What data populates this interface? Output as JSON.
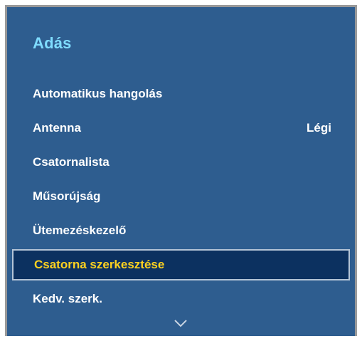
{
  "colors": {
    "panel_bg": "#2e5d8f",
    "title": "#7fdcff",
    "text": "#ffffff",
    "selected_text": "#ffd21f",
    "selected_bg": "#0c3160"
  },
  "menu": {
    "title": "Adás",
    "items": [
      {
        "label": "Automatikus hangolás",
        "value": ""
      },
      {
        "label": "Antenna",
        "value": "Légi"
      },
      {
        "label": "Csatornalista",
        "value": ""
      },
      {
        "label": "Műsorújság",
        "value": ""
      },
      {
        "label": "Ütemezéskezelő",
        "value": ""
      },
      {
        "label": "Csatorna szerkesztése",
        "value": "",
        "selected": true
      },
      {
        "label": "Kedv. szerk.",
        "value": ""
      }
    ]
  },
  "icons": {
    "scroll_down": "chevron-down-icon"
  }
}
